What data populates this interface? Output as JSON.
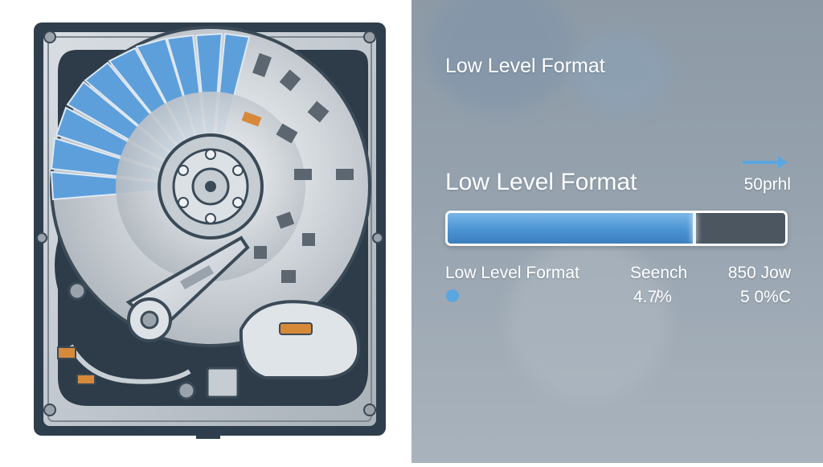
{
  "illustration": {
    "subject": "hard-disk-drive",
    "colors": {
      "platter": "#c9ced4",
      "sector_highlight": "#5d9fdb",
      "frame": "#2f3e4c",
      "body": "#bfc6cd"
    }
  },
  "panel": {
    "window_title": "Low Level Format",
    "section_title": "Low Level Format",
    "speed": "50prhl",
    "progress": {
      "fraction": 0.73,
      "color": "#4a93d3",
      "track_color": "#4b5661"
    },
    "stats": {
      "label": "Low Level Format",
      "search_label": "Seench",
      "search_value": "4.7̸%",
      "right_label": "850 Jow",
      "right_value": "5 0%C"
    },
    "colors": {
      "background": "#95a2ae",
      "text": "#ffffff",
      "status_dot": "#5aa6e0"
    }
  }
}
